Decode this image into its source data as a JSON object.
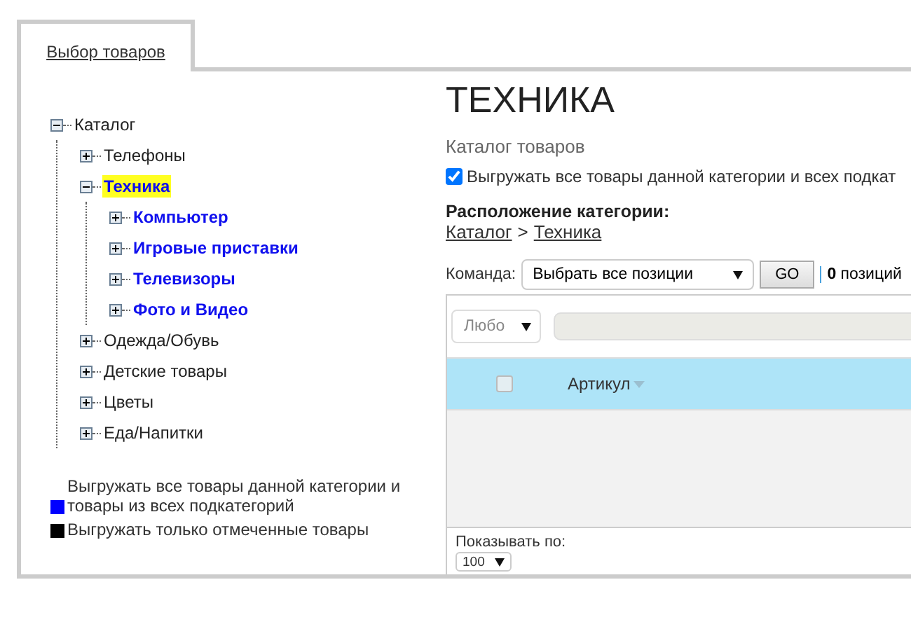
{
  "tabs": [
    {
      "label": "Выбор товаров",
      "selected": true
    }
  ],
  "tree": [
    {
      "label": "Каталог",
      "expanded": true,
      "selected": false,
      "export_all": false,
      "children": [
        {
          "label": "Телефоны",
          "expanded": false,
          "selected": false,
          "export_all": false
        },
        {
          "label": "Техника",
          "expanded": true,
          "selected": true,
          "export_all": true,
          "children": [
            {
              "label": "Компьютер",
              "expanded": false,
              "selected": false,
              "export_all": true
            },
            {
              "label": "Игровые приставки",
              "expanded": false,
              "selected": false,
              "export_all": true
            },
            {
              "label": "Телевизоры",
              "expanded": false,
              "selected": false,
              "export_all": true
            },
            {
              "label": "Фото и Видео",
              "expanded": false,
              "selected": false,
              "export_all": true
            }
          ]
        },
        {
          "label": "Одежда/Обувь",
          "expanded": false,
          "selected": false,
          "export_all": false
        },
        {
          "label": "Детские товары",
          "expanded": false,
          "selected": false,
          "export_all": false
        },
        {
          "label": "Цветы",
          "expanded": false,
          "selected": false,
          "export_all": false
        },
        {
          "label": "Еда/Напитки",
          "expanded": false,
          "selected": false,
          "export_all": false
        }
      ]
    }
  ],
  "legend": [
    {
      "color": "#0000ff",
      "text": "Выгружать все товары данной категории и товары из всех подкатегорий"
    },
    {
      "color": "#000000",
      "text": "Выгружать только отмеченные товары"
    }
  ],
  "category": {
    "title": "ТЕХНИКА",
    "subtitle": "Каталог товаров",
    "export_all_checkbox": {
      "label": "Выгружать все товары данной категории и всех подкат",
      "checked": true
    },
    "location_label": "Расположение категории:",
    "breadcrumb": [
      {
        "label": "Каталог"
      },
      {
        "label": "Техника"
      }
    ],
    "breadcrumb_separator": ">"
  },
  "command_bar": {
    "label": "Команда:",
    "select": "Выбрать все позиции",
    "button": "GO",
    "count": "0",
    "count_text": "позиций"
  },
  "grid": {
    "filter_select": "Любо",
    "header_checked": false,
    "columns": [
      {
        "label": "Артикул"
      }
    ],
    "page_size_label": "Показывать по:",
    "page_size": "100"
  }
}
